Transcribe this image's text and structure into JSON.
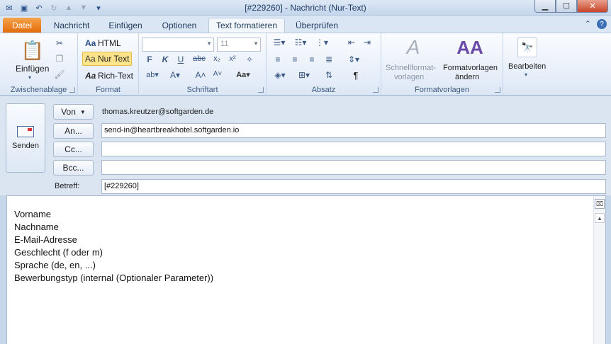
{
  "window": {
    "title": "[#229260]  -  Nachricht (Nur-Text)"
  },
  "tabs": [
    {
      "label": "Datei"
    },
    {
      "label": "Nachricht"
    },
    {
      "label": "Einfügen"
    },
    {
      "label": "Optionen"
    },
    {
      "label": "Text formatieren"
    },
    {
      "label": "Überprüfen"
    }
  ],
  "ribbon": {
    "clipboard": {
      "label": "Zwischenablage",
      "paste": "Einfügen"
    },
    "format": {
      "label": "Format",
      "html": "HTML",
      "plain": "Nur Text",
      "rich": "Rich-Text",
      "prefix": "Aa"
    },
    "font": {
      "label": "Schriftart",
      "size": "11"
    },
    "paragraph": {
      "label": "Absatz"
    },
    "styles": {
      "label": "Formatvorlagen",
      "quick_line1": "Schnellformat-",
      "quick_line2": "vorlagen",
      "change_line1": "Formatvorlagen",
      "change_line2": "ändern"
    },
    "edit": {
      "label": "Bearbeiten"
    }
  },
  "header": {
    "send": "Senden",
    "from_btn": "Von",
    "from_value": "thomas.kreutzer@softgarden.de",
    "to_btn": "An...",
    "to_value": "send-in@heartbreakhotel.softgarden.io",
    "cc_btn": "Cc...",
    "cc_value": "",
    "bcc_btn": "Bcc...",
    "bcc_value": "",
    "subject_label": "Betreff:",
    "subject_value": "[#229260]"
  },
  "body": {
    "lines": [
      "Vorname",
      "Nachname",
      "E-Mail-Adresse",
      "Geschlecht (f oder m)",
      "Sprache (de, en, ...)",
      "Bewerbungstyp (internal (Optionaler Parameter))"
    ]
  },
  "colors": {
    "file_tab": "#e46c0a",
    "highlight": "#fde48a"
  }
}
